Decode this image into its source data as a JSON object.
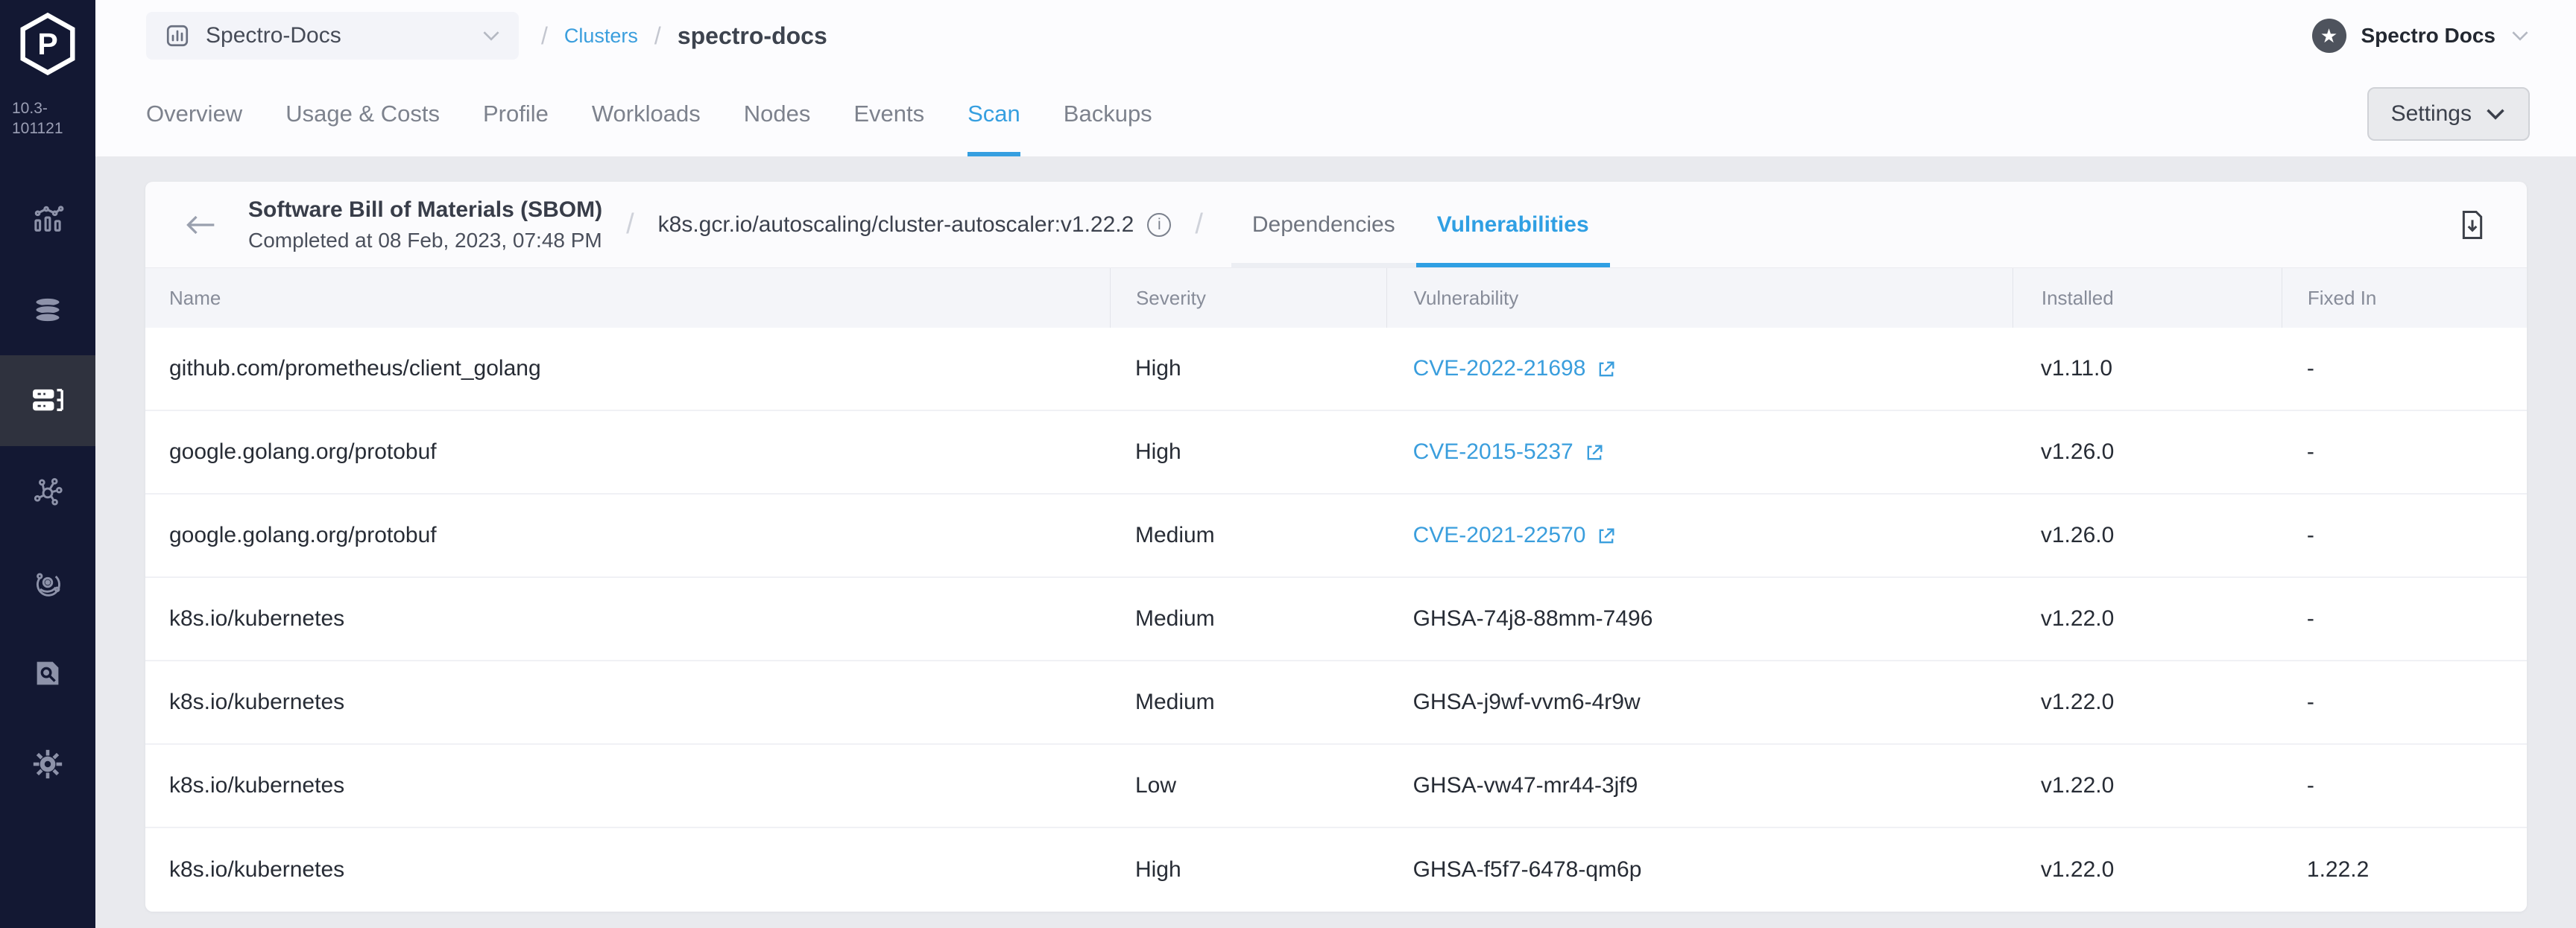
{
  "app": {
    "version": "10.3-101121",
    "logo_icon": "palette-hexagon-logo"
  },
  "colors": {
    "accent_blue": "#36a0e0",
    "link_blue": "#3a9edd",
    "sidebar_bg": "#131833",
    "sidebar_active_bg": "#2f323e",
    "content_bg": "#e9eaee"
  },
  "sidebar": {
    "items": [
      {
        "icon": "monitoring-chart-icon",
        "active": false
      },
      {
        "icon": "profiles-stack-icon",
        "active": false
      },
      {
        "icon": "clusters-servers-icon",
        "active": true
      },
      {
        "icon": "workspaces-network-icon",
        "active": false
      },
      {
        "icon": "registries-orbit-icon",
        "active": false
      },
      {
        "icon": "audit-search-doc-icon",
        "active": false
      },
      {
        "icon": "settings-gear-icon",
        "active": false
      }
    ]
  },
  "topbar": {
    "project_selector": {
      "label": "Spectro-Docs",
      "icon": "bar-chart-icon",
      "chevron": "chevron-down-icon"
    },
    "breadcrumb": {
      "separator": "/",
      "link": "Clusters",
      "current": "spectro-docs"
    },
    "account": {
      "label": "Spectro Docs",
      "avatar_icon": "star-icon",
      "star_glyph": "★"
    },
    "settings_button": {
      "label": "Settings"
    }
  },
  "main_tabs": [
    {
      "label": "Overview",
      "active": false
    },
    {
      "label": "Usage & Costs",
      "active": false
    },
    {
      "label": "Profile",
      "active": false
    },
    {
      "label": "Workloads",
      "active": false
    },
    {
      "label": "Nodes",
      "active": false
    },
    {
      "label": "Events",
      "active": false
    },
    {
      "label": "Scan",
      "active": true
    },
    {
      "label": "Backups",
      "active": false
    }
  ],
  "scan_panel": {
    "back_icon": "arrow-left-icon",
    "title": "Software Bill of Materials (SBOM)",
    "subtitle": "Completed at 08 Feb, 2023, 07:48 PM",
    "separator": "/",
    "image_ref": "k8s.gcr.io/autoscaling/cluster-autoscaler:v1.22.2",
    "info_icon": "info-icon",
    "info_glyph": "i",
    "sub_tabs": [
      {
        "label": "Dependencies",
        "active": false
      },
      {
        "label": "Vulnerabilities",
        "active": true
      }
    ],
    "download_icon": "download-file-icon"
  },
  "table": {
    "columns": [
      "Name",
      "Severity",
      "Vulnerability",
      "Installed",
      "Fixed In"
    ],
    "rows": [
      {
        "name": "github.com/prometheus/client_golang",
        "severity": "High",
        "vulnerability": "CVE-2022-21698",
        "vulnerability_is_link": true,
        "installed": "v1.11.0",
        "fixed_in": "-"
      },
      {
        "name": "google.golang.org/protobuf",
        "severity": "High",
        "vulnerability": "CVE-2015-5237",
        "vulnerability_is_link": true,
        "installed": "v1.26.0",
        "fixed_in": "-"
      },
      {
        "name": "google.golang.org/protobuf",
        "severity": "Medium",
        "vulnerability": "CVE-2021-22570",
        "vulnerability_is_link": true,
        "installed": "v1.26.0",
        "fixed_in": "-"
      },
      {
        "name": "k8s.io/kubernetes",
        "severity": "Medium",
        "vulnerability": "GHSA-74j8-88mm-7496",
        "vulnerability_is_link": false,
        "installed": "v1.22.0",
        "fixed_in": "-"
      },
      {
        "name": "k8s.io/kubernetes",
        "severity": "Medium",
        "vulnerability": "GHSA-j9wf-vvm6-4r9w",
        "vulnerability_is_link": false,
        "installed": "v1.22.0",
        "fixed_in": "-"
      },
      {
        "name": "k8s.io/kubernetes",
        "severity": "Low",
        "vulnerability": "GHSA-vw47-mr44-3jf9",
        "vulnerability_is_link": false,
        "installed": "v1.22.0",
        "fixed_in": "-"
      },
      {
        "name": "k8s.io/kubernetes",
        "severity": "High",
        "vulnerability": "GHSA-f5f7-6478-qm6p",
        "vulnerability_is_link": false,
        "installed": "v1.22.0",
        "fixed_in": "1.22.2"
      }
    ]
  }
}
